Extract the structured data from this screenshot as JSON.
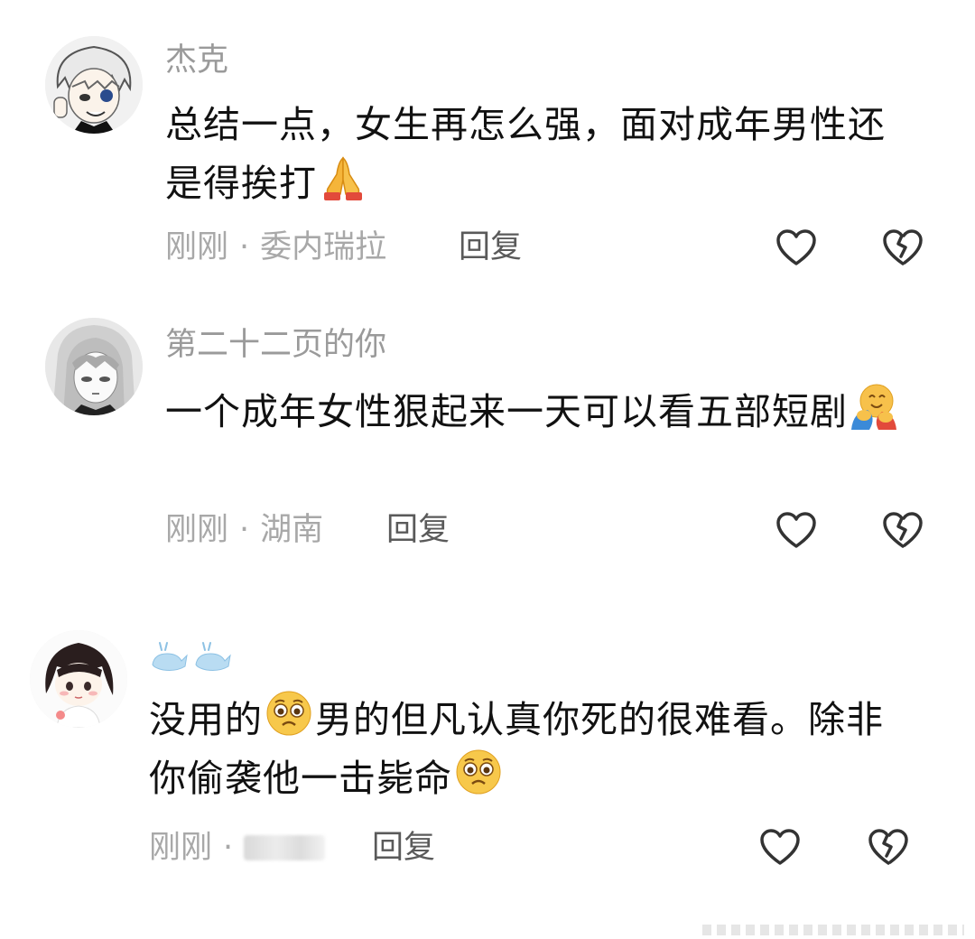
{
  "comments": [
    {
      "username": "杰克",
      "text_before_emoji": "总结一点，女生再怎么强，面对成年男性还是得挨打",
      "emoji": "folded-hands-emoji",
      "meta_time": "刚刚",
      "meta_dot": "·",
      "meta_location": "委内瑞拉",
      "reply_label": "回复"
    },
    {
      "username": "第二十二页的你",
      "text_before_emoji": "一个成年女性狠起来一天可以看五部短剧",
      "emoji": "hugging-face-emoji",
      "meta_time": "刚刚",
      "meta_dot": "·",
      "meta_location": "湖南",
      "reply_label": "回复"
    },
    {
      "username_icon": "whale-emoji-pair",
      "text_part1": "没用的",
      "emoji1": "pleading-face-emoji",
      "text_part2": "男的但凡认真你死的很难看。除非你偷袭他一击毙命",
      "emoji2": "pleading-face-emoji",
      "meta_time": "刚刚",
      "meta_dot": "·",
      "reply_label": "回复"
    }
  ],
  "icons": {
    "like": "heart-outline-icon",
    "dislike": "broken-heart-outline-icon"
  },
  "colors": {
    "username": "#9a9a9a",
    "text": "#111111",
    "meta": "#a8a8a8",
    "reply": "#5a5a5a",
    "icon_stroke": "#333333"
  }
}
